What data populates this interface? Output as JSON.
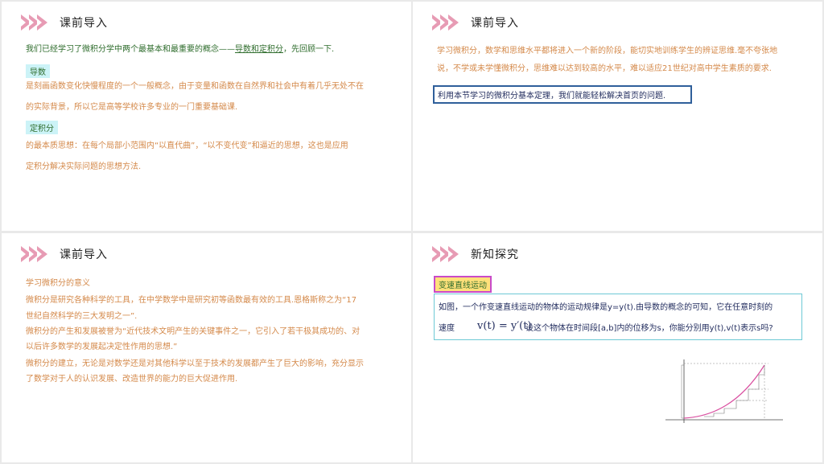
{
  "slide1": {
    "title": "课前导入",
    "intro": "我们已经学习了微积分学中两个最基本和最重要的概念——",
    "intro_link": "导数和定积分",
    "intro_end": "，先回顾一下.",
    "tag1": "导数",
    "p1a": "是刻画函数变化快慢程度的一个一般概念，由于变量和函数在自然界和社会中有着几乎无处不在",
    "p1b": "的实际背景，所以它是高等学校许多专业的一门重要基础课.",
    "tag2": "定积分",
    "p2a": "的最本质思想：在每个局部小范围内“以直代曲”，“以不变代变”和逼近的思想，这也是应用",
    "p2b": "定积分解决实际问题的思想方法."
  },
  "slide2": {
    "title": "课前导入",
    "p1a": "学习微积分，数学和思维水平都将进入一个新的阶段，能切实地训练学生的辨证思维.毫不夸张地",
    "p1b": "说，不学或未学懂微积分，思维难以达到较高的水平，难以适应21世纪对高中学生素质的要求.",
    "boxed": "利用本节学习的微积分基本定理，我们就能轻松解决首页的问题."
  },
  "slide3": {
    "title": "课前导入",
    "heading": "学习微积分的意义",
    "l1": "微积分是研究各种科学的工具，在中学数学中是研究初等函数最有效的工具.恩格斯称之为“17",
    "l2": "世纪自然科学的三大发明之一”.",
    "l3": "微积分的产生和发展被誉为“近代技术文明产生的关键事件之一，它引入了若干极其成功的、对",
    "l4": "以后许多数学的发展起决定性作用的思想.”",
    "l5": "微积分的建立，无论是对数学还是对其他科学以至于技术的发展都产生了巨大的影响，充分显示",
    "l6": "了数学对于人的认识发展、改造世界的能力的巨大促进作用."
  },
  "slide4": {
    "title": "新知探究",
    "tag": "变速直线运动",
    "q1": "如图，一个作变速直线运动的物体的运动规律是y=y(t).由导数的概念的可知，它在任意时刻的",
    "q2a": "速度",
    "formula": "v(t) = y′(t)",
    "q2b": "设这个物体在时间段[a,b]内的位移为s，你能分别用y(t),v(t)表示s吗?"
  },
  "colors": {
    "chevron": "#e79bb4",
    "green": "#2f6d2d",
    "orange": "#d4894a",
    "tag_bg": "#ccf3f7"
  }
}
